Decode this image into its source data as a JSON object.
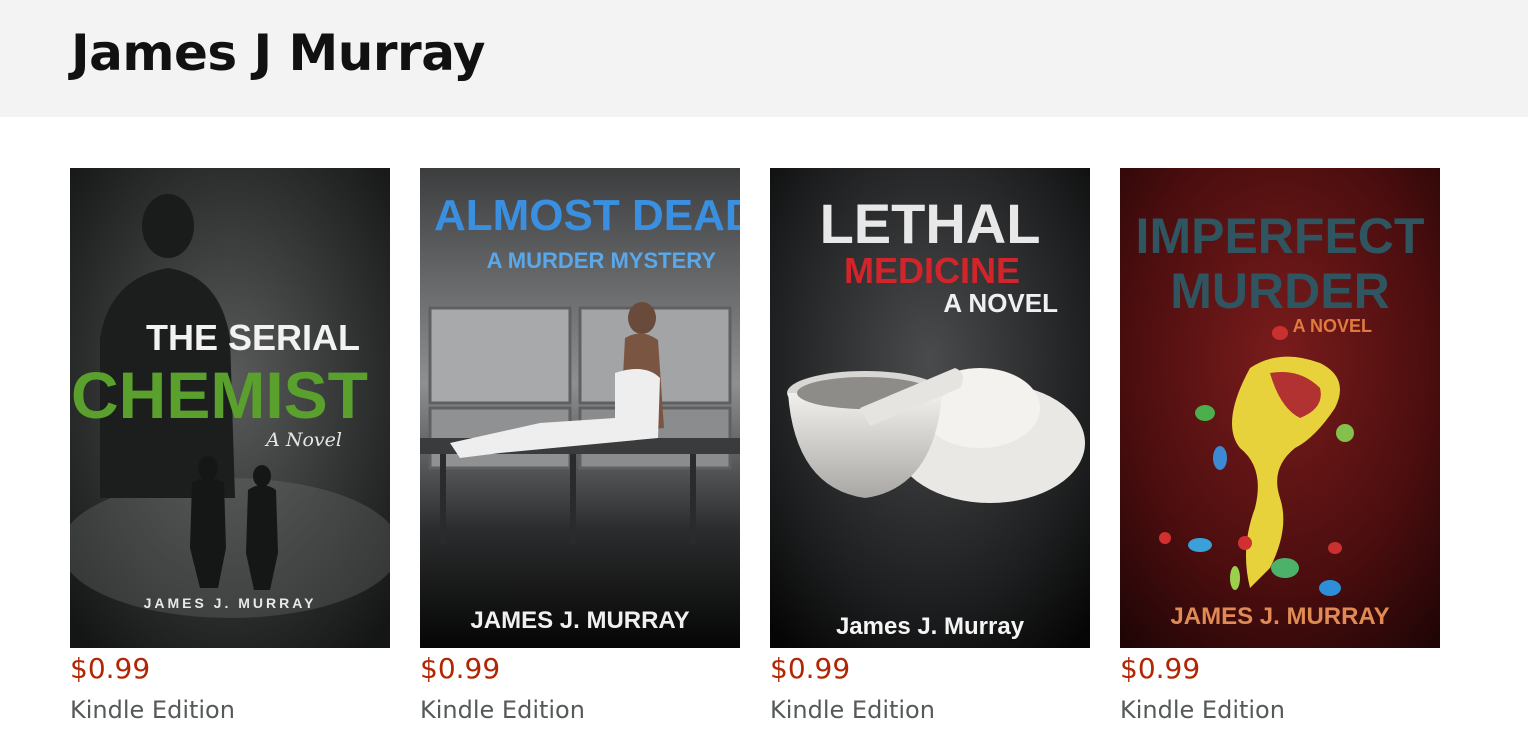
{
  "author": {
    "name": "James J Murray"
  },
  "books": [
    {
      "cover": {
        "title_line1": "THE SERIAL",
        "title_line2": "CHEMIST",
        "subtitle": "A Novel",
        "author": "JAMES J. MURRAY"
      },
      "price": "$0.99",
      "format": "Kindle Edition"
    },
    {
      "cover": {
        "title_line1": "ALMOST DEAD",
        "subtitle": "A MURDER MYSTERY",
        "author": "JAMES J. MURRAY"
      },
      "price": "$0.99",
      "format": "Kindle Edition"
    },
    {
      "cover": {
        "title_line1": "LETHAL",
        "title_line2": "MEDICINE",
        "subtitle": "A NOVEL",
        "author": "James J. Murray"
      },
      "price": "$0.99",
      "format": "Kindle Edition"
    },
    {
      "cover": {
        "title_line1": "IMPERFECT",
        "title_line2": "MURDER",
        "subtitle": "A NOVEL",
        "author": "JAMES J. MURRAY"
      },
      "price": "$0.99",
      "format": "Kindle Edition"
    }
  ],
  "colors": {
    "price": "#b12704",
    "format": "#565959",
    "header_bg": "#f3f3f3"
  }
}
